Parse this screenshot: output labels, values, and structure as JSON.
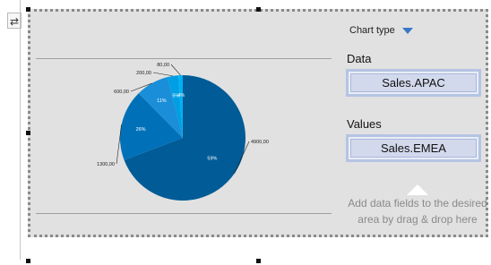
{
  "panel": {
    "chart_type_label": "Chart type",
    "data_label": "Data",
    "data_field": "Sales.APAC",
    "values_label": "Values",
    "values_field": "Sales.EMEA",
    "hint": "Add data fields to the desired area by drag & drop here"
  },
  "chart_data": {
    "type": "pie",
    "slices": [
      {
        "value": 4900,
        "percent": "59%",
        "value_label": "4900,00",
        "color": "#005b96"
      },
      {
        "value": 1300,
        "percent": "26%",
        "value_label": "1300,00",
        "color": "#0071b8"
      },
      {
        "value": 600,
        "percent": "11%",
        "value_label": "600,00",
        "color": "#1a8ed8"
      },
      {
        "value": 200,
        "percent": "5%",
        "value_label": "200,00",
        "color": "#009fe3"
      },
      {
        "value": 80,
        "percent": "4%",
        "value_label": "80,00",
        "color": "#00b0f5"
      }
    ]
  }
}
